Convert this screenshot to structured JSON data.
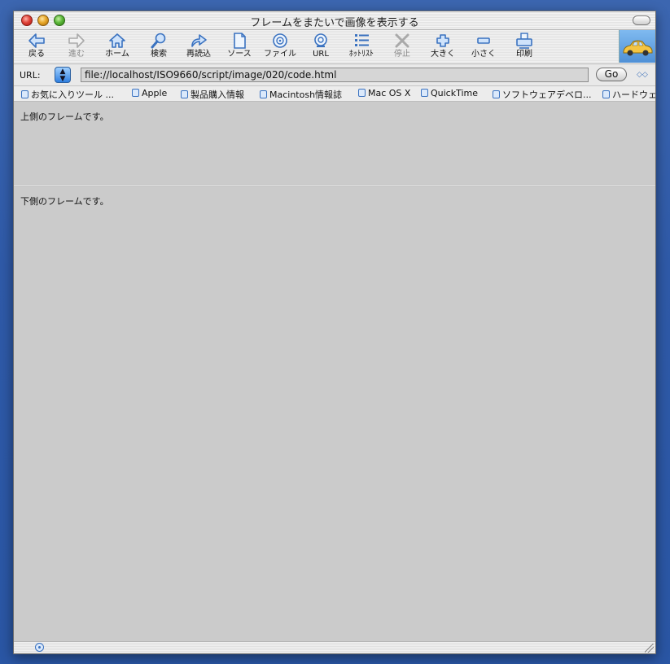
{
  "window": {
    "title": "フレームをまたいで画像を表示する"
  },
  "toolbar": {
    "buttons": [
      {
        "label": "戻る",
        "icon": "back-arrow-icon"
      },
      {
        "label": "進む",
        "icon": "forward-arrow-icon"
      },
      {
        "label": "ホーム",
        "icon": "home-icon"
      },
      {
        "label": "検索",
        "icon": "search-icon"
      },
      {
        "label": "再読込",
        "icon": "reload-icon"
      },
      {
        "label": "ソース",
        "icon": "source-icon"
      },
      {
        "label": "ファイル",
        "icon": "file-icon"
      },
      {
        "label": "URL",
        "icon": "url-icon"
      },
      {
        "label": "ﾎｯﾄﾘｽﾄ",
        "icon": "hotlist-icon"
      },
      {
        "label": "停止",
        "icon": "stop-icon"
      },
      {
        "label": "大きく",
        "icon": "larger-icon"
      },
      {
        "label": "小さく",
        "icon": "smaller-icon"
      },
      {
        "label": "印刷",
        "icon": "print-icon"
      }
    ]
  },
  "address": {
    "label": "URL:",
    "value": "file://localhost/ISO9660/script/image/020/code.html",
    "go_label": "Go"
  },
  "favorites": [
    {
      "label": "お気に入りツール ..."
    },
    {
      "label": "Apple"
    },
    {
      "label": "製品購入情報"
    },
    {
      "label": "Macintosh情報誌"
    },
    {
      "label": "Mac OS X"
    },
    {
      "label": "QuickTime"
    },
    {
      "label": "ソフトウェアデベロ..."
    },
    {
      "label": "ハードウェ"
    }
  ],
  "frames": {
    "top_text": "上側のフレームです。",
    "bottom_text": "下側のフレームです。"
  },
  "colors": {
    "icon_blue": "#3a72c0",
    "frame_bg": "#cbcbcb"
  }
}
